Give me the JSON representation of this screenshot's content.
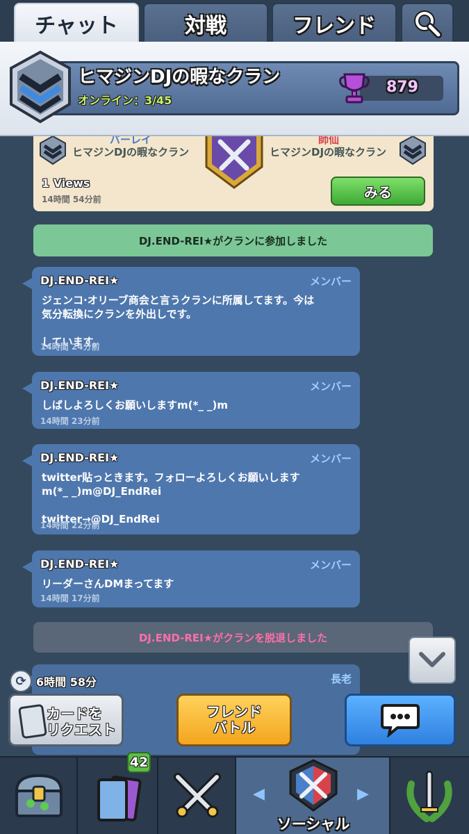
{
  "tabs": {
    "chat": "チャット",
    "battle": "対戦",
    "friend": "フレンド",
    "search_icon": "magnifier-icon"
  },
  "clan": {
    "name": "ヒマジンDJの暇なクラン",
    "online": "オンライン：3/45",
    "trophies": "879"
  },
  "replay": {
    "left_top": "バーレイ",
    "right_top": "師仙",
    "left_name": "ヒマジンDJの暇なクラン",
    "right_name": "ヒマジンDJの暇なクラン",
    "views": "1 Views",
    "time": "14時間 54分前",
    "watch_label": "みる"
  },
  "system": {
    "join": "DJ.END-REI★がクランに参加しました",
    "leave": "DJ.END-REI★がクランを脱退しました"
  },
  "messages": [
    {
      "name": "DJ.END-REI★",
      "role": "メンバー",
      "text": "ジェンコ·オリーブ商会と言うクランに所属してます。今は\n気分転換にクランを外出しです。\n\nしています。",
      "time": "14時間 24分前"
    },
    {
      "name": "DJ.END-REI★",
      "role": "メンバー",
      "text": "しばしよろしくお願いしますm(*_ _)m",
      "time": "14時間 23分前"
    },
    {
      "name": "DJ.END-REI★",
      "role": "メンバー",
      "text": "twitter貼っときます。フォローよろしくお願いします\nm(*_ _)m@DJ_EndRei\n\ntwitter→@DJ_EndRei",
      "time": "14時間 22分前"
    },
    {
      "name": "DJ.END-REI★",
      "role": "メンバー",
      "text": "リーダーさんDMまってます",
      "time": "14時間 17分前"
    },
    {
      "name": "",
      "role": "長老",
      "text": "",
      "time": ""
    }
  ],
  "timer": "6時間 58分",
  "actions": {
    "request_card": "カードを\nリクエスト",
    "friend_battle": "フレンド\nバトル",
    "chat_icon": "speech-bubble-icon"
  },
  "nav": {
    "cards_badge": "42",
    "social_label": "ソーシャル"
  },
  "colors": {
    "background": "#34495e",
    "bubble": "#4e77ad",
    "join_line": "#7bc896",
    "leave_text": "#ff6fa6",
    "watch_button": "#3fa935",
    "friend_battle_button": "#f3a51e",
    "chat_button": "#2f80e0"
  }
}
